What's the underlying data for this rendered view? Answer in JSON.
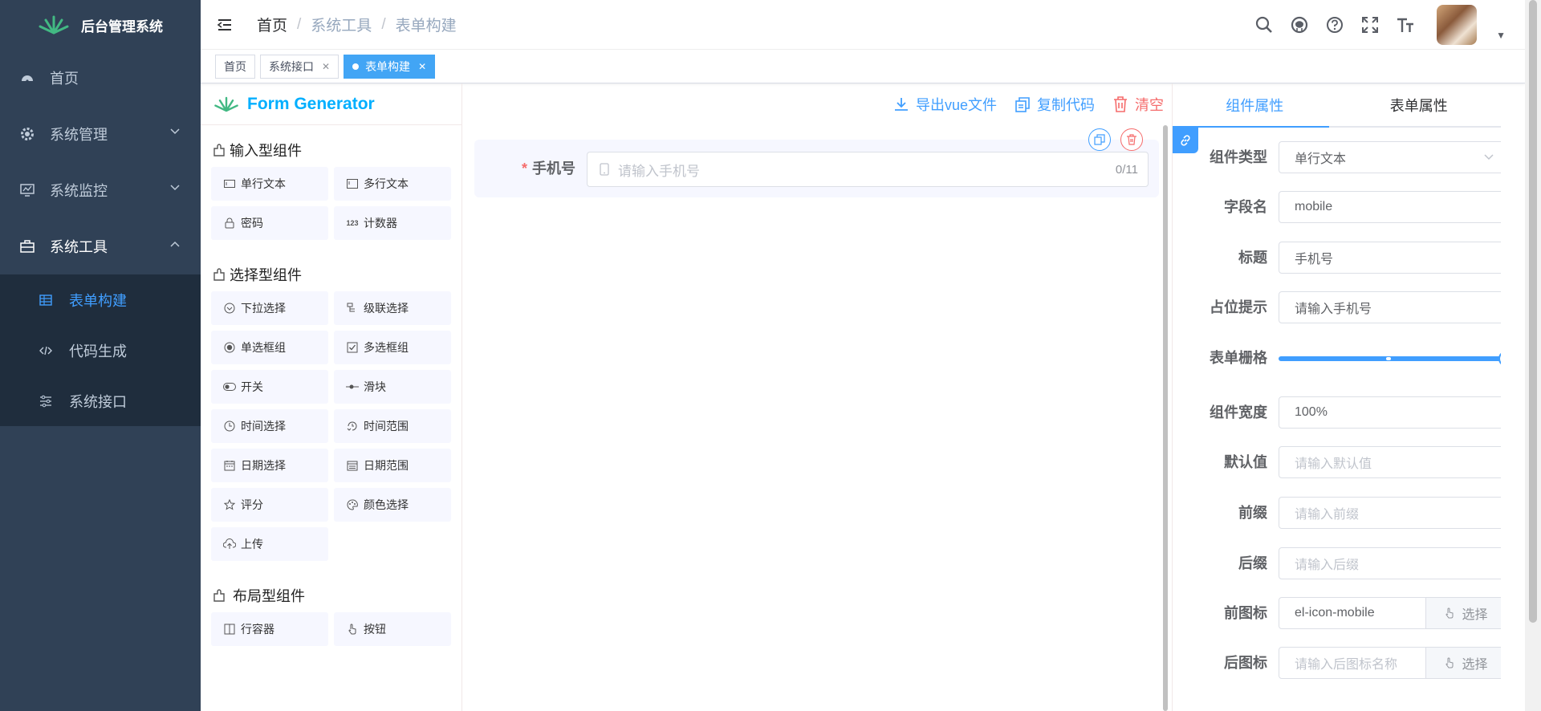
{
  "app": {
    "title": "后台管理系统"
  },
  "sidebar": {
    "items": [
      {
        "label": "首页"
      },
      {
        "label": "系统管理"
      },
      {
        "label": "系统监控"
      },
      {
        "label": "系统工具"
      }
    ],
    "sub_items": [
      {
        "label": "表单构建"
      },
      {
        "label": "代码生成"
      },
      {
        "label": "系统接口"
      }
    ]
  },
  "breadcrumb": {
    "items": [
      "首页",
      "系统工具",
      "表单构建"
    ]
  },
  "tags": {
    "items": [
      {
        "label": "首页"
      },
      {
        "label": "系统接口"
      },
      {
        "label": "表单构建"
      }
    ]
  },
  "generator": {
    "title": "Form Generator",
    "export_label": "导出vue文件",
    "copy_label": "复制代码",
    "clear_label": "清空"
  },
  "components": {
    "groups": [
      {
        "title": "输入型组件",
        "items": [
          "单行文本",
          "多行文本",
          "密码",
          "计数器"
        ]
      },
      {
        "title": "选择型组件",
        "items": [
          "下拉选择",
          "级联选择",
          "单选框组",
          "多选框组",
          "开关",
          "滑块",
          "时间选择",
          "时间范围",
          "日期选择",
          "日期范围",
          "评分",
          "颜色选择",
          "上传"
        ]
      },
      {
        "title": "布局型组件",
        "items": [
          "行容器",
          "按钮"
        ]
      }
    ]
  },
  "canvas": {
    "field_label": "手机号",
    "placeholder": "请输入手机号",
    "counter": "0/11"
  },
  "right_panel": {
    "tabs": [
      "组件属性",
      "表单属性"
    ],
    "props": {
      "type": {
        "label": "组件类型",
        "value": "单行文本"
      },
      "field": {
        "label": "字段名",
        "value": "mobile"
      },
      "title": {
        "label": "标题",
        "value": "手机号"
      },
      "placeholder": {
        "label": "占位提示",
        "value": "请输入手机号"
      },
      "span": {
        "label": "表单栅格",
        "value": 24
      },
      "width": {
        "label": "组件宽度",
        "value": "100%"
      },
      "default": {
        "label": "默认值",
        "placeholder": "请输入默认值"
      },
      "prefix": {
        "label": "前缀",
        "placeholder": "请输入前缀"
      },
      "suffix": {
        "label": "后缀",
        "placeholder": "请输入后缀"
      },
      "prefix_icon": {
        "label": "前图标",
        "value": "el-icon-mobile",
        "button": "选择"
      },
      "suffix_icon": {
        "label": "后图标",
        "placeholder": "请输入后图标名称",
        "button": "选择"
      }
    }
  },
  "colors": {
    "primary": "#409eff",
    "sidebar_bg": "#304156",
    "danger": "#f56c6c"
  }
}
